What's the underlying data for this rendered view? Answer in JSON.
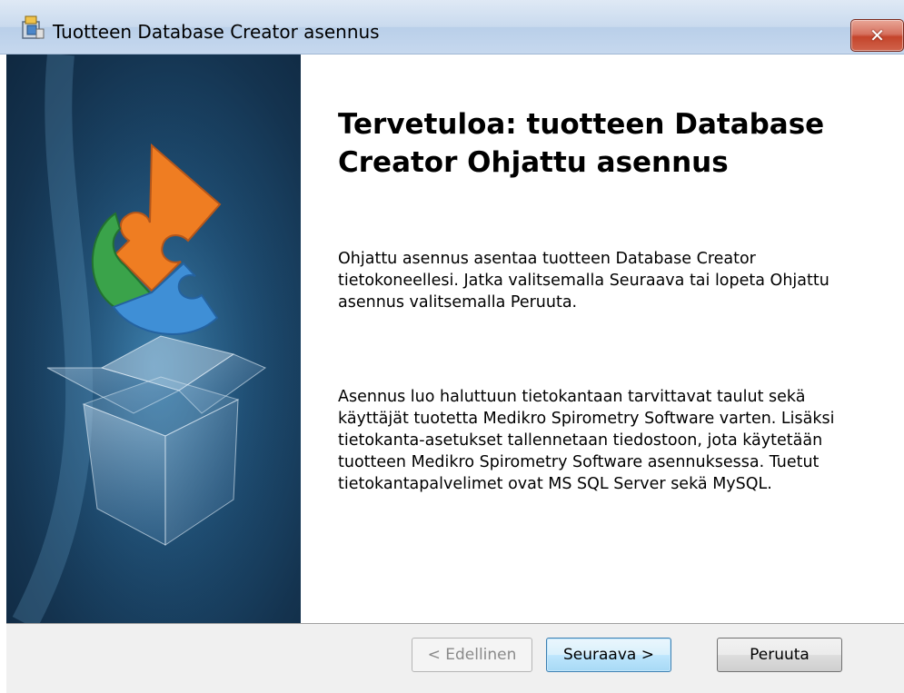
{
  "window": {
    "title": "Tuotteen Database Creator asennus",
    "close_label": "✕"
  },
  "content": {
    "heading": "Tervetuloa: tuotteen Database Creator Ohjattu asennus",
    "paragraph1": "Ohjattu asennus asentaa tuotteen Database Creator tietokoneellesi.  Jatka valitsemalla Seuraava tai lopeta Ohjattu asennus valitsemalla Peruuta.",
    "paragraph2": "Asennus luo haluttuun tietokantaan tarvittavat taulut sekä käyttäjät tuotetta Medikro Spirometry Software varten. Lisäksi tietokanta-asetukset tallennetaan tiedostoon, jota käytetään tuotteen Medikro Spirometry Software asennuksessa. Tuetut tietokantapalvelimet ovat MS SQL Server sekä MySQL."
  },
  "buttons": {
    "prev_label": "< Edellinen",
    "next_label": "Seuraava >",
    "cancel_label": "Peruuta"
  },
  "icons": {
    "window_icon": "installer-icon",
    "banner_image": "puzzle-box-graphic"
  },
  "colors": {
    "banner_bg": "#1e4e74",
    "puzzle_orange": "#ef7d22",
    "puzzle_green": "#3aa34a",
    "puzzle_blue": "#3f8fd6",
    "close_red": "#c4442b"
  }
}
